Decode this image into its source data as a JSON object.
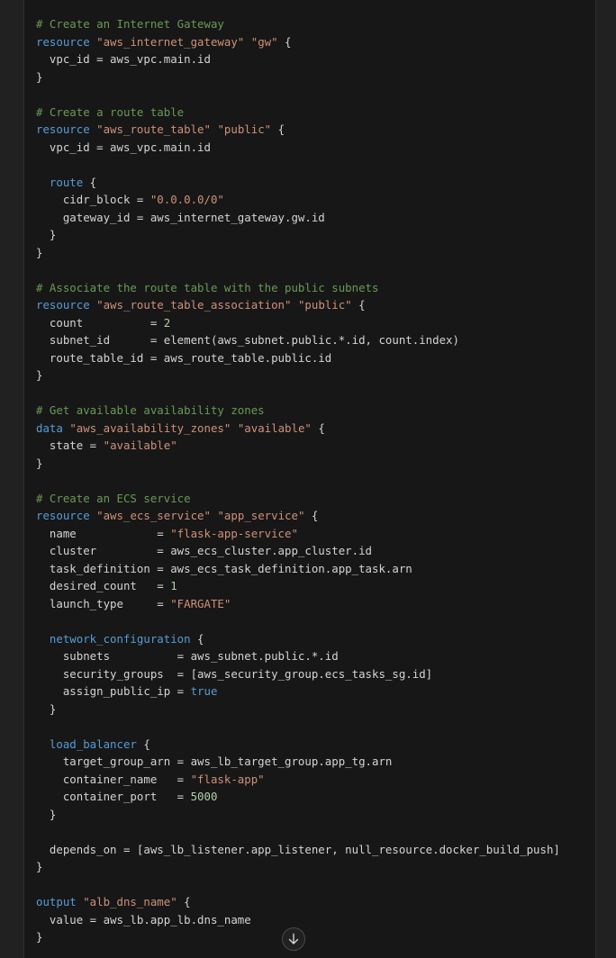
{
  "colors": {
    "page_bg": "#212121",
    "code_bg": "#171717",
    "comment": "#6a9955",
    "keyword": "#569cd6",
    "string": "#ce9178",
    "number": "#b5cea8",
    "text": "#d4d4d4"
  },
  "scroll_button": {
    "icon": "arrow-down-icon"
  },
  "code_lines": [
    [
      {
        "t": "c",
        "v": "# Create an Internet Gateway"
      }
    ],
    [
      {
        "t": "k",
        "v": "resource "
      },
      {
        "t": "s",
        "v": "\"aws_internet_gateway\""
      },
      {
        "t": "t",
        "v": " "
      },
      {
        "t": "s",
        "v": "\"gw\""
      },
      {
        "t": "t",
        "v": " {"
      }
    ],
    [
      {
        "t": "t",
        "v": "  vpc_id = aws_vpc.main.id"
      }
    ],
    [
      {
        "t": "t",
        "v": "}"
      }
    ],
    [
      {
        "t": "t",
        "v": ""
      }
    ],
    [
      {
        "t": "c",
        "v": "# Create a route table"
      }
    ],
    [
      {
        "t": "k",
        "v": "resource "
      },
      {
        "t": "s",
        "v": "\"aws_route_table\""
      },
      {
        "t": "t",
        "v": " "
      },
      {
        "t": "s",
        "v": "\"public\""
      },
      {
        "t": "t",
        "v": " {"
      }
    ],
    [
      {
        "t": "t",
        "v": "  vpc_id = aws_vpc.main.id"
      }
    ],
    [
      {
        "t": "t",
        "v": ""
      }
    ],
    [
      {
        "t": "k",
        "v": "  route"
      },
      {
        "t": "t",
        "v": " {"
      }
    ],
    [
      {
        "t": "t",
        "v": "    cidr_block = "
      },
      {
        "t": "s",
        "v": "\"0.0.0.0/0\""
      }
    ],
    [
      {
        "t": "t",
        "v": "    gateway_id = aws_internet_gateway.gw.id"
      }
    ],
    [
      {
        "t": "t",
        "v": "  }"
      }
    ],
    [
      {
        "t": "t",
        "v": "}"
      }
    ],
    [
      {
        "t": "t",
        "v": ""
      }
    ],
    [
      {
        "t": "c",
        "v": "# Associate the route table with the public subnets"
      }
    ],
    [
      {
        "t": "k",
        "v": "resource "
      },
      {
        "t": "s",
        "v": "\"aws_route_table_association\""
      },
      {
        "t": "t",
        "v": " "
      },
      {
        "t": "s",
        "v": "\"public\""
      },
      {
        "t": "t",
        "v": " {"
      }
    ],
    [
      {
        "t": "t",
        "v": "  count          = "
      },
      {
        "t": "n",
        "v": "2"
      }
    ],
    [
      {
        "t": "t",
        "v": "  subnet_id      = element(aws_subnet.public.*.id, count.index)"
      }
    ],
    [
      {
        "t": "t",
        "v": "  route_table_id = aws_route_table.public.id"
      }
    ],
    [
      {
        "t": "t",
        "v": "}"
      }
    ],
    [
      {
        "t": "t",
        "v": ""
      }
    ],
    [
      {
        "t": "c",
        "v": "# Get available availability zones"
      }
    ],
    [
      {
        "t": "k",
        "v": "data "
      },
      {
        "t": "s",
        "v": "\"aws_availability_zones\""
      },
      {
        "t": "t",
        "v": " "
      },
      {
        "t": "s",
        "v": "\"available\""
      },
      {
        "t": "t",
        "v": " {"
      }
    ],
    [
      {
        "t": "t",
        "v": "  state = "
      },
      {
        "t": "s",
        "v": "\"available\""
      }
    ],
    [
      {
        "t": "t",
        "v": "}"
      }
    ],
    [
      {
        "t": "t",
        "v": ""
      }
    ],
    [
      {
        "t": "c",
        "v": "# Create an ECS service"
      }
    ],
    [
      {
        "t": "k",
        "v": "resource "
      },
      {
        "t": "s",
        "v": "\"aws_ecs_service\""
      },
      {
        "t": "t",
        "v": " "
      },
      {
        "t": "s",
        "v": "\"app_service\""
      },
      {
        "t": "t",
        "v": " {"
      }
    ],
    [
      {
        "t": "t",
        "v": "  name            = "
      },
      {
        "t": "s",
        "v": "\"flask-app-service\""
      }
    ],
    [
      {
        "t": "t",
        "v": "  cluster         = aws_ecs_cluster.app_cluster.id"
      }
    ],
    [
      {
        "t": "t",
        "v": "  task_definition = aws_ecs_task_definition.app_task.arn"
      }
    ],
    [
      {
        "t": "t",
        "v": "  desired_count   = "
      },
      {
        "t": "n",
        "v": "1"
      }
    ],
    [
      {
        "t": "t",
        "v": "  launch_type     = "
      },
      {
        "t": "s",
        "v": "\"FARGATE\""
      }
    ],
    [
      {
        "t": "t",
        "v": ""
      }
    ],
    [
      {
        "t": "k",
        "v": "  network_configuration"
      },
      {
        "t": "t",
        "v": " {"
      }
    ],
    [
      {
        "t": "t",
        "v": "    subnets          = aws_subnet.public.*.id"
      }
    ],
    [
      {
        "t": "t",
        "v": "    security_groups  = [aws_security_group.ecs_tasks_sg.id]"
      }
    ],
    [
      {
        "t": "t",
        "v": "    assign_public_ip = "
      },
      {
        "t": "b",
        "v": "true"
      }
    ],
    [
      {
        "t": "t",
        "v": "  }"
      }
    ],
    [
      {
        "t": "t",
        "v": ""
      }
    ],
    [
      {
        "t": "k",
        "v": "  load_balancer"
      },
      {
        "t": "t",
        "v": " {"
      }
    ],
    [
      {
        "t": "t",
        "v": "    target_group_arn = aws_lb_target_group.app_tg.arn"
      }
    ],
    [
      {
        "t": "t",
        "v": "    container_name   = "
      },
      {
        "t": "s",
        "v": "\"flask-app\""
      }
    ],
    [
      {
        "t": "t",
        "v": "    container_port   = "
      },
      {
        "t": "n",
        "v": "5000"
      }
    ],
    [
      {
        "t": "t",
        "v": "  }"
      }
    ],
    [
      {
        "t": "t",
        "v": ""
      }
    ],
    [
      {
        "t": "t",
        "v": "  depends_on = [aws_lb_listener.app_listener, null_resource.docker_build_push]"
      }
    ],
    [
      {
        "t": "t",
        "v": "}"
      }
    ],
    [
      {
        "t": "t",
        "v": ""
      }
    ],
    [
      {
        "t": "k",
        "v": "output "
      },
      {
        "t": "s",
        "v": "\"alb_dns_name\""
      },
      {
        "t": "t",
        "v": " {"
      }
    ],
    [
      {
        "t": "t",
        "v": "  value = aws_lb.app_lb.dns_name"
      }
    ],
    [
      {
        "t": "t",
        "v": "}"
      }
    ]
  ]
}
